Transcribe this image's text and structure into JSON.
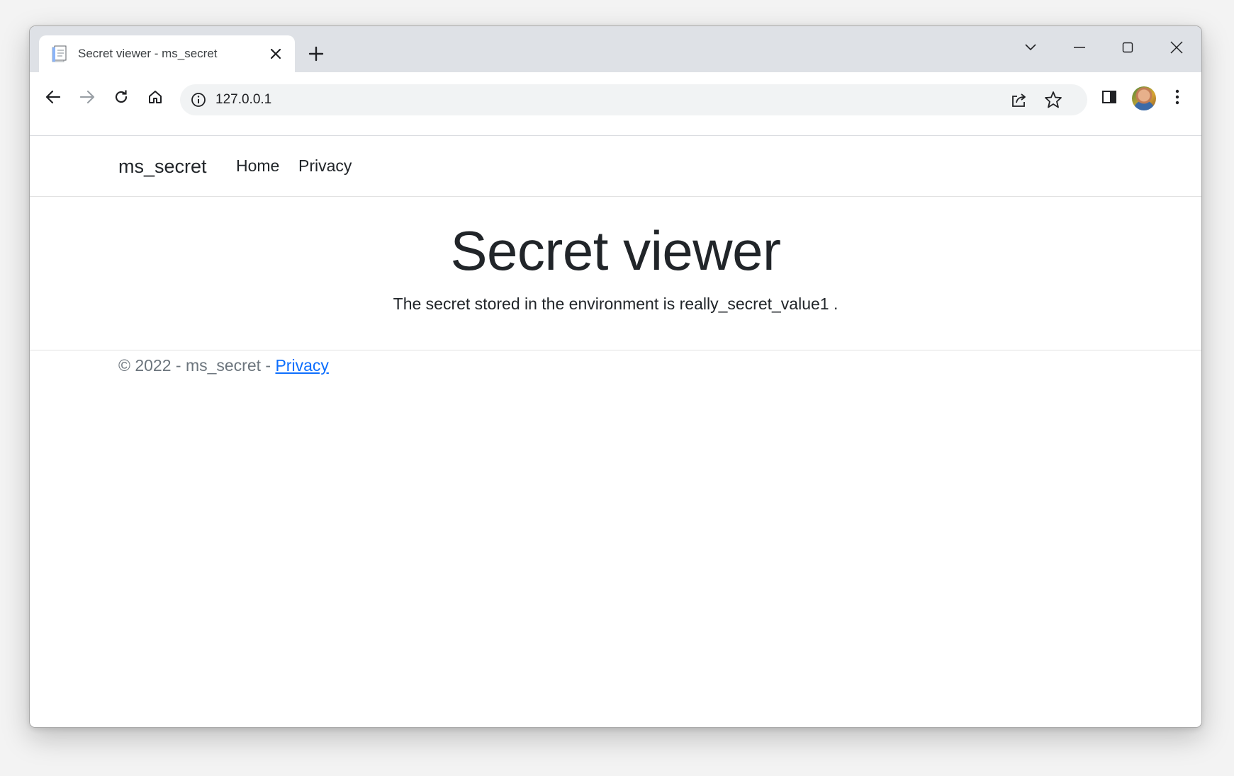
{
  "browser": {
    "tab": {
      "title": "Secret viewer - ms_secret"
    },
    "address_bar": {
      "url": "127.0.0.1"
    },
    "icons": [
      "document-favicon-icon",
      "close-icon",
      "plus-icon",
      "chevron-down-icon",
      "minimize-icon",
      "maximize-icon",
      "close-window-icon",
      "back-arrow-icon",
      "forward-arrow-icon",
      "reload-icon",
      "home-icon",
      "info-icon",
      "share-icon",
      "star-icon",
      "side-panel-icon",
      "kebab-menu-icon"
    ]
  },
  "navbar": {
    "brand": "ms_secret",
    "links": [
      {
        "label": "Home"
      },
      {
        "label": "Privacy"
      }
    ]
  },
  "main": {
    "title": "Secret viewer",
    "text": "The secret stored in the environment is really_secret_value1 ."
  },
  "footer": {
    "prefix": "© 2022 - ms_secret - ",
    "link_label": "Privacy"
  },
  "colors": {
    "tabstrip": "#dee1e6",
    "omnibox": "#f1f3f4",
    "link": "#0d6efd",
    "text": "#212529",
    "muted": "#6c757d"
  }
}
